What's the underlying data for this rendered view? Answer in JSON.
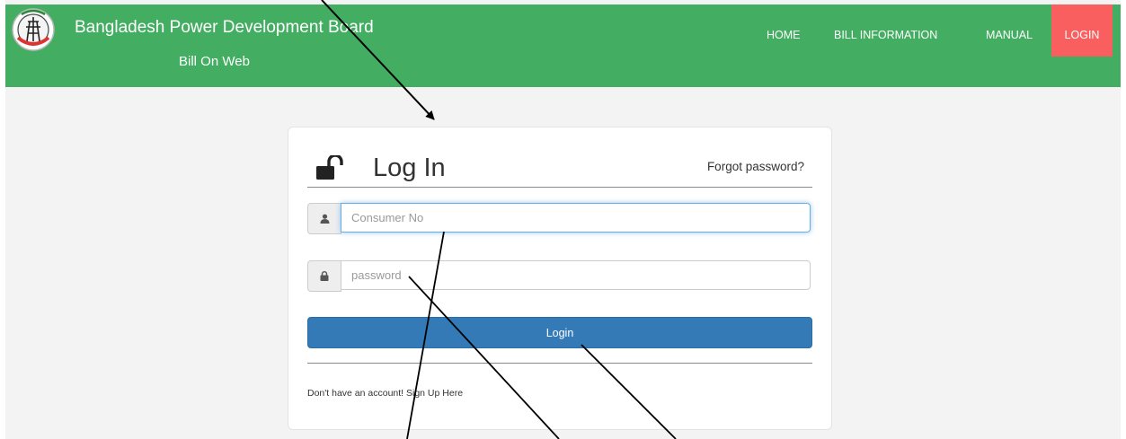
{
  "navbar": {
    "brand_title": "Bangladesh Power Development Board",
    "brand_subtitle": "Bill On Web",
    "logo_icon": "bpdb-logo-icon",
    "items": [
      {
        "label": "HOME"
      },
      {
        "label": "BILL INFORMATION"
      },
      {
        "label": "MANUAL"
      },
      {
        "label": "LOGIN",
        "active": true
      }
    ],
    "bg_color": "#43ae62",
    "active_color": "#fa5f5f"
  },
  "login_card": {
    "title": "Log In",
    "title_icon": "unlocked-padlock-icon",
    "forgot_password": "Forgot password?",
    "consumer_no": {
      "placeholder": "Consumer No",
      "value": "",
      "icon": "user-icon"
    },
    "password": {
      "placeholder": "password",
      "value": "",
      "icon": "lock-icon"
    },
    "login_button": "Login",
    "signup_prefix": "Don't have an account!",
    "signup_link": "Sign Up Here",
    "button_color": "#337ab7"
  }
}
